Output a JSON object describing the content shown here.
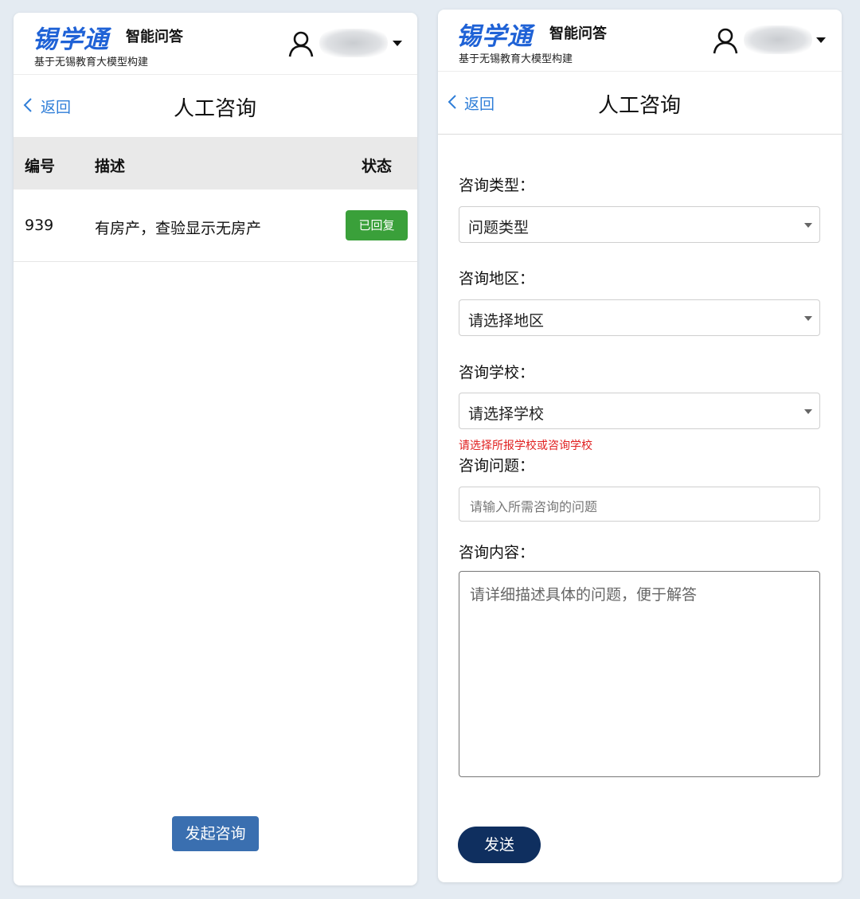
{
  "brand": {
    "name": "锡学通",
    "product": "智能问答",
    "tagline": "基于无锡教育大模型构建"
  },
  "nav": {
    "back_label": "返回",
    "page_title": "人工咨询"
  },
  "left": {
    "table": {
      "headers": [
        "编号",
        "描述",
        "状态"
      ],
      "rows": [
        {
          "id": "939",
          "desc": "有房产，查验显示无房产",
          "status": "已回复"
        }
      ]
    },
    "start_button": "发起咨询"
  },
  "right": {
    "form": {
      "type_label": "咨询类型：",
      "type_value": "问题类型",
      "region_label": "咨询地区：",
      "region_value": "请选择地区",
      "school_label": "咨询学校：",
      "school_value": "请选择学校",
      "school_hint": "请选择所报学校或咨询学校",
      "question_label": "咨询问题：",
      "question_placeholder": "请输入所需咨询的问题",
      "content_label": "咨询内容：",
      "content_placeholder": "请详细描述具体的问题，便于解答"
    },
    "send_button": "发送"
  },
  "colors": {
    "brand_blue": "#1f62d6",
    "link_blue": "#2f7ed8",
    "status_green": "#3aa03a",
    "start_button": "#3a6fb0",
    "send_button": "#0f2f5f",
    "hint_red": "#e02020"
  },
  "icons": {
    "user": "user-icon",
    "back": "chevron-left-icon",
    "dropdown": "caret-down-icon"
  }
}
